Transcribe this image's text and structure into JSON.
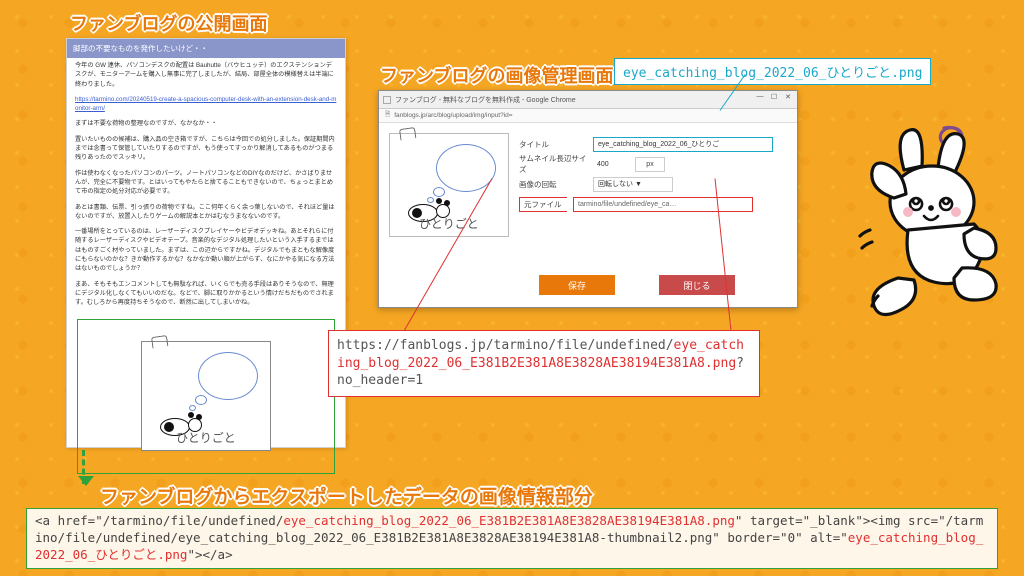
{
  "headings": {
    "public": "ファンブログの公開画面",
    "admin": "ファンブログの画像管理画面",
    "export": "ファンブログからエクスポートしたデータの画像情報部分"
  },
  "pngName": "eye_catching_blog_2022_06_ひとりごと.png",
  "blog": {
    "title": "脚部の不要なものを発作したいけど・・",
    "p1": "今年の GW 連休、パソコンデスクの配置は Bauhutte（バウヒュッテ）のエクステンションデスクが、モニターアームを購入し無事に完了しましたが、結局、部屋全体の模様替えは半端に終わりました。",
    "link": "https://tarmino.com/20240519-create-a-spacious-computer-desk-with-an-extension-desk-and-monitor-arm/",
    "p2": "まずは不要な荷物の整理なのですが、なかなか・・",
    "p3": "置いたいものの候補は、購入品の空き箱ですが、こちらは今回での処分しました。保証期間内までは念書って保管していたりするのですが、もう使ってすっかり解消してあるものがつまる残りあったのでスッキリ。",
    "p4": "作は使わなくなったパソコンのパーツ。ノートパソコンなどのDIYなのだけど、かさばりませんが、完全に不要物です。とはいってもやたらと捨てることもできないので、ちょっとまとめて市の指定の処分対応が必要です。",
    "p5": "あとは書類、伝票、引っ張りの荷物ですね。ここ何年くらく余っ葉しないので、それほど量はないのですが、放置入したりゲームの解説本とかはむなうまなないのです。",
    "p6": "一番場所をとっているのは、レーザーディスクプレイヤーやビデオデッキね。あとそれらに付随するレーザーディスクやビデオテープ。音楽的なデジタル処理したいという入手するまでははものすごく材やっていました。まずは、この辺からですかね。デジタルでもまともな解像度にもらないのかな？きか動作するかな？なかなか動い順が上がらず、なにかやる気になる方法はないものでしょうか？",
    "p7": "まあ、そもそもエンコメントしても無駄なれば、いくらでも売る手段はありそうなので、無理にデジタル化しなくてもいいのだな。などで、脚に取りかかるという情けだちだものでされます。むしろから再度持ちそうなので、断然に出してしまいかね。",
    "imgCaption": "ひとりごと"
  },
  "admin": {
    "tab": "ファンブログ - 無料なブログを無料作成 - Google Chrome",
    "addr": "fanblogs.jp/arc/blog/upload/img/input?id=",
    "labels": {
      "title": "タイトル",
      "thumb": "サムネイル長辺サイズ",
      "rot": "画像の回転",
      "file": "元ファイル"
    },
    "vals": {
      "title": "eye_catching_blog_2022_06_ひとりご",
      "thumbW": "400",
      "unit": "px",
      "rot": "回転しない ▼",
      "file": "tarmino/file/undefined/eye_ca…"
    },
    "btn": {
      "save": "保存",
      "close": "閉じる"
    },
    "thumbCaption": "ひとりごと"
  },
  "url": {
    "pre": "https://fanblogs.jp/tarmino/file/undefined/",
    "mid": "eye_catching_blog_2022_06_E381B2E381A8E3828AE38194E381A8.png",
    "suf": "?no_header=1"
  },
  "export": {
    "t1": "<a href=\"/tarmino/file/undefined/",
    "r1": "eye_catching_blog_2022_06_E381B2E381A8E3828AE38194E381A8.png",
    "t2": "\" target=\"_blank\"><img src=\"/tarmino/file/undefined/eye_catching_blog_2022_06_E381B2E381A8E3828AE38194E381A8-thumbnail2.png\" border=\"0\" alt=\"",
    "r2": "eye_catching_blog_2022_06_ひとりごと.png",
    "t3": "\"></a>"
  }
}
